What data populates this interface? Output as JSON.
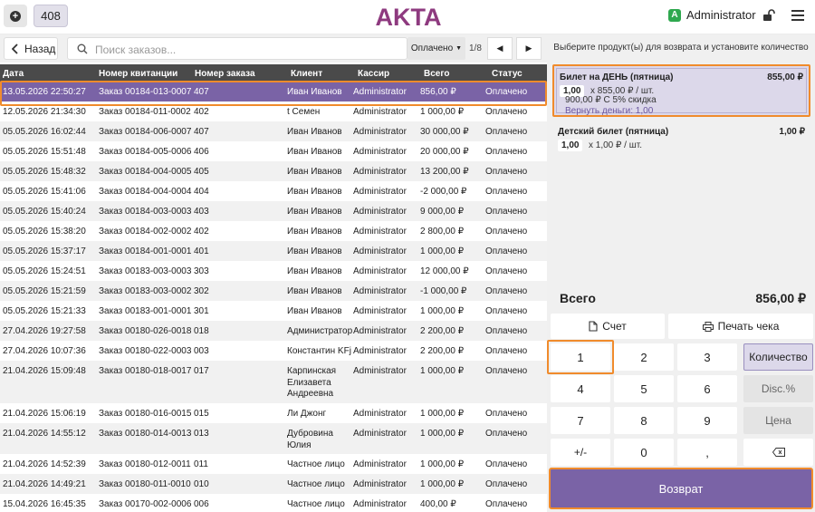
{
  "header": {
    "order_number": "408",
    "logo_text": "AKTA",
    "user_initial": "A",
    "user_name": "Administrator"
  },
  "toolbar": {
    "back_label": "Назад",
    "search_placeholder": "Поиск заказов...",
    "status_filter": "Оплачено",
    "page_info": "1/8"
  },
  "table": {
    "columns": [
      "Дата",
      "Номер квитанции",
      "Номер заказа",
      "Клиент",
      "Кассир",
      "Всего",
      "Статус"
    ],
    "rows": [
      {
        "date": "13.05.2026 22:50:27",
        "receipt": "Заказ 00184-013-0007",
        "order": "407",
        "client": "Иван Иванов",
        "cashier": "Administrator",
        "total": "856,00 ₽",
        "status": "Оплачено",
        "selected": true
      },
      {
        "date": "12.05.2026 21:34:30",
        "receipt": "Заказ 00184-011-0002",
        "order": "402",
        "client": "t Семен",
        "cashier": "Administrator",
        "total": "1 000,00 ₽",
        "status": "Оплачено"
      },
      {
        "date": "05.05.2026 16:02:44",
        "receipt": "Заказ 00184-006-0007",
        "order": "407",
        "client": "Иван Иванов",
        "cashier": "Administrator",
        "total": "30 000,00 ₽",
        "status": "Оплачено"
      },
      {
        "date": "05.05.2026 15:51:48",
        "receipt": "Заказ 00184-005-0006",
        "order": "406",
        "client": "Иван Иванов",
        "cashier": "Administrator",
        "total": "20 000,00 ₽",
        "status": "Оплачено"
      },
      {
        "date": "05.05.2026 15:48:32",
        "receipt": "Заказ 00184-004-0005",
        "order": "405",
        "client": "Иван Иванов",
        "cashier": "Administrator",
        "total": "13 200,00 ₽",
        "status": "Оплачено"
      },
      {
        "date": "05.05.2026 15:41:06",
        "receipt": "Заказ 00184-004-0004",
        "order": "404",
        "client": "Иван Иванов",
        "cashier": "Administrator",
        "total": "-2 000,00 ₽",
        "status": "Оплачено"
      },
      {
        "date": "05.05.2026 15:40:24",
        "receipt": "Заказ 00184-003-0003",
        "order": "403",
        "client": "Иван Иванов",
        "cashier": "Administrator",
        "total": "9 000,00 ₽",
        "status": "Оплачено"
      },
      {
        "date": "05.05.2026 15:38:20",
        "receipt": "Заказ 00184-002-0002",
        "order": "402",
        "client": "Иван Иванов",
        "cashier": "Administrator",
        "total": "2 800,00 ₽",
        "status": "Оплачено"
      },
      {
        "date": "05.05.2026 15:37:17",
        "receipt": "Заказ 00184-001-0001",
        "order": "401",
        "client": "Иван Иванов",
        "cashier": "Administrator",
        "total": "1 000,00 ₽",
        "status": "Оплачено"
      },
      {
        "date": "05.05.2026 15:24:51",
        "receipt": "Заказ 00183-003-0003",
        "order": "303",
        "client": "Иван Иванов",
        "cashier": "Administrator",
        "total": "12 000,00 ₽",
        "status": "Оплачено"
      },
      {
        "date": "05.05.2026 15:21:59",
        "receipt": "Заказ 00183-003-0002",
        "order": "302",
        "client": "Иван Иванов",
        "cashier": "Administrator",
        "total": "-1 000,00 ₽",
        "status": "Оплачено"
      },
      {
        "date": "05.05.2026 15:21:33",
        "receipt": "Заказ 00183-001-0001",
        "order": "301",
        "client": "Иван Иванов",
        "cashier": "Administrator",
        "total": "1 000,00 ₽",
        "status": "Оплачено"
      },
      {
        "date": "27.04.2026 19:27:58",
        "receipt": "Заказ 00180-026-0018",
        "order": "018",
        "client": "Администратор",
        "cashier": "Administrator",
        "total": "2 200,00 ₽",
        "status": "Оплачено"
      },
      {
        "date": "27.04.2026 10:07:36",
        "receipt": "Заказ 00180-022-0003",
        "order": "003",
        "client": "Константин KFj",
        "cashier": "Administrator",
        "total": "2 200,00 ₽",
        "status": "Оплачено"
      },
      {
        "date": "21.04.2026 15:09:48",
        "receipt": "Заказ 00180-018-0017",
        "order": "017",
        "client": "Карпинская Елизавета Андреевна",
        "cashier": "Administrator",
        "total": "1 000,00 ₽",
        "status": "Оплачено"
      },
      {
        "date": "21.04.2026 15:06:19",
        "receipt": "Заказ 00180-016-0015",
        "order": "015",
        "client": "Ли Джонг",
        "cashier": "Administrator",
        "total": "1 000,00 ₽",
        "status": "Оплачено"
      },
      {
        "date": "21.04.2026 14:55:12",
        "receipt": "Заказ 00180-014-0013",
        "order": "013",
        "client": "Дубровина Юлия",
        "cashier": "Administrator",
        "total": "1 000,00 ₽",
        "status": "Оплачено"
      },
      {
        "date": "21.04.2026 14:52:39",
        "receipt": "Заказ 00180-012-0011",
        "order": "011",
        "client": "Частное лицо",
        "cashier": "Administrator",
        "total": "1 000,00 ₽",
        "status": "Оплачено"
      },
      {
        "date": "21.04.2026 14:49:21",
        "receipt": "Заказ 00180-011-0010",
        "order": "010",
        "client": "Частное лицо",
        "cashier": "Administrator",
        "total": "1 000,00 ₽",
        "status": "Оплачено"
      },
      {
        "date": "15.04.2026 16:45:35",
        "receipt": "Заказ 00170-002-0006",
        "order": "006",
        "client": "Частное лицо",
        "cashier": "Administrator",
        "total": "400,00 ₽",
        "status": "Оплачено"
      }
    ]
  },
  "refund_panel": {
    "instruction": "Выберите продукт(ы) для возврата и установите количество",
    "items": [
      {
        "name": "Билет на ДЕНЬ (пятница)",
        "price": "855,00 ₽",
        "qty": "1,00",
        "unit": "x 855,00 ₽ / шт.",
        "discount": "900,00 ₽ С 5% скидка",
        "refund": "Вернуть деньги: 1,00"
      },
      {
        "name": "Детский билет (пятница)",
        "price": "1,00 ₽",
        "qty": "1,00",
        "unit": "x 1,00 ₽ / шт."
      }
    ],
    "total_label": "Всего",
    "total_value": "856,00 ₽",
    "invoice_label": "Счет",
    "print_label": "Печать чека",
    "keys": {
      "k1": "1",
      "k2": "2",
      "k3": "3",
      "qty": "Количество",
      "k4": "4",
      "k5": "5",
      "k6": "6",
      "disc": "Disc.%",
      "k7": "7",
      "k8": "8",
      "k9": "9",
      "price": "Цена",
      "sign": "+/-",
      "k0": "0",
      "comma": ","
    },
    "refund_button": "Возврат"
  },
  "colors": {
    "accent": "#7a63a6",
    "highlight": "#f08b2c",
    "header_bg": "#4a4a4a"
  }
}
